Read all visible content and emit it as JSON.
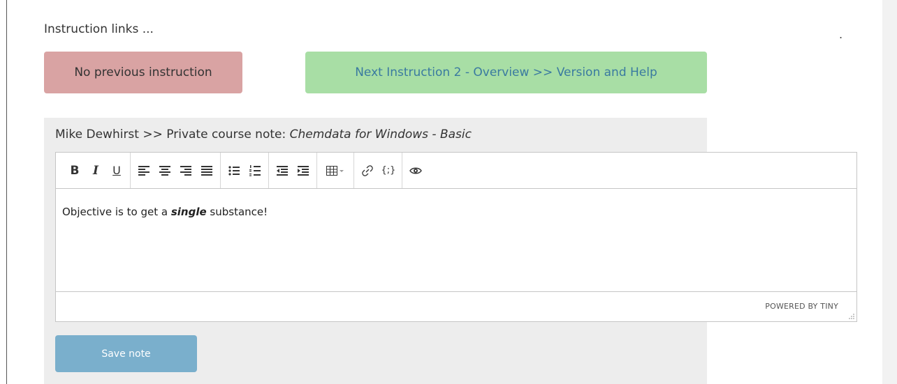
{
  "instruction_links": {
    "heading": "Instruction links ...",
    "prev_label": "No previous instruction",
    "next_label": "Next Instruction 2 - Overview >> Version and Help",
    "prev_color": "#d9a3a3",
    "next_color": "#a8dea5"
  },
  "page": {
    "stray_dot": "."
  },
  "note": {
    "author": "Mike Dewhirst",
    "separator": ">>",
    "label": "Private course note:",
    "course": "Chemdata for Windows - Basic"
  },
  "editor": {
    "toolbar": {
      "bold": "B",
      "italic": "I",
      "underline": "U",
      "code_sample": "{;}",
      "icons": [
        "bold-icon",
        "italic-icon",
        "underline-icon",
        "align-left-icon",
        "align-center-icon",
        "align-right-icon",
        "align-justify-icon",
        "bullet-list-icon",
        "numbered-list-icon",
        "outdent-icon",
        "indent-icon",
        "table-icon",
        "link-icon",
        "code-icon",
        "preview-icon"
      ]
    },
    "content": {
      "before": "Objective is to get a ",
      "emphasis": "single",
      "after": " substance!"
    },
    "branding": "POWERED BY TINY"
  },
  "save_label": "Save note",
  "colors": {
    "save_button": "#7aafcc",
    "panel": "#ededed"
  }
}
